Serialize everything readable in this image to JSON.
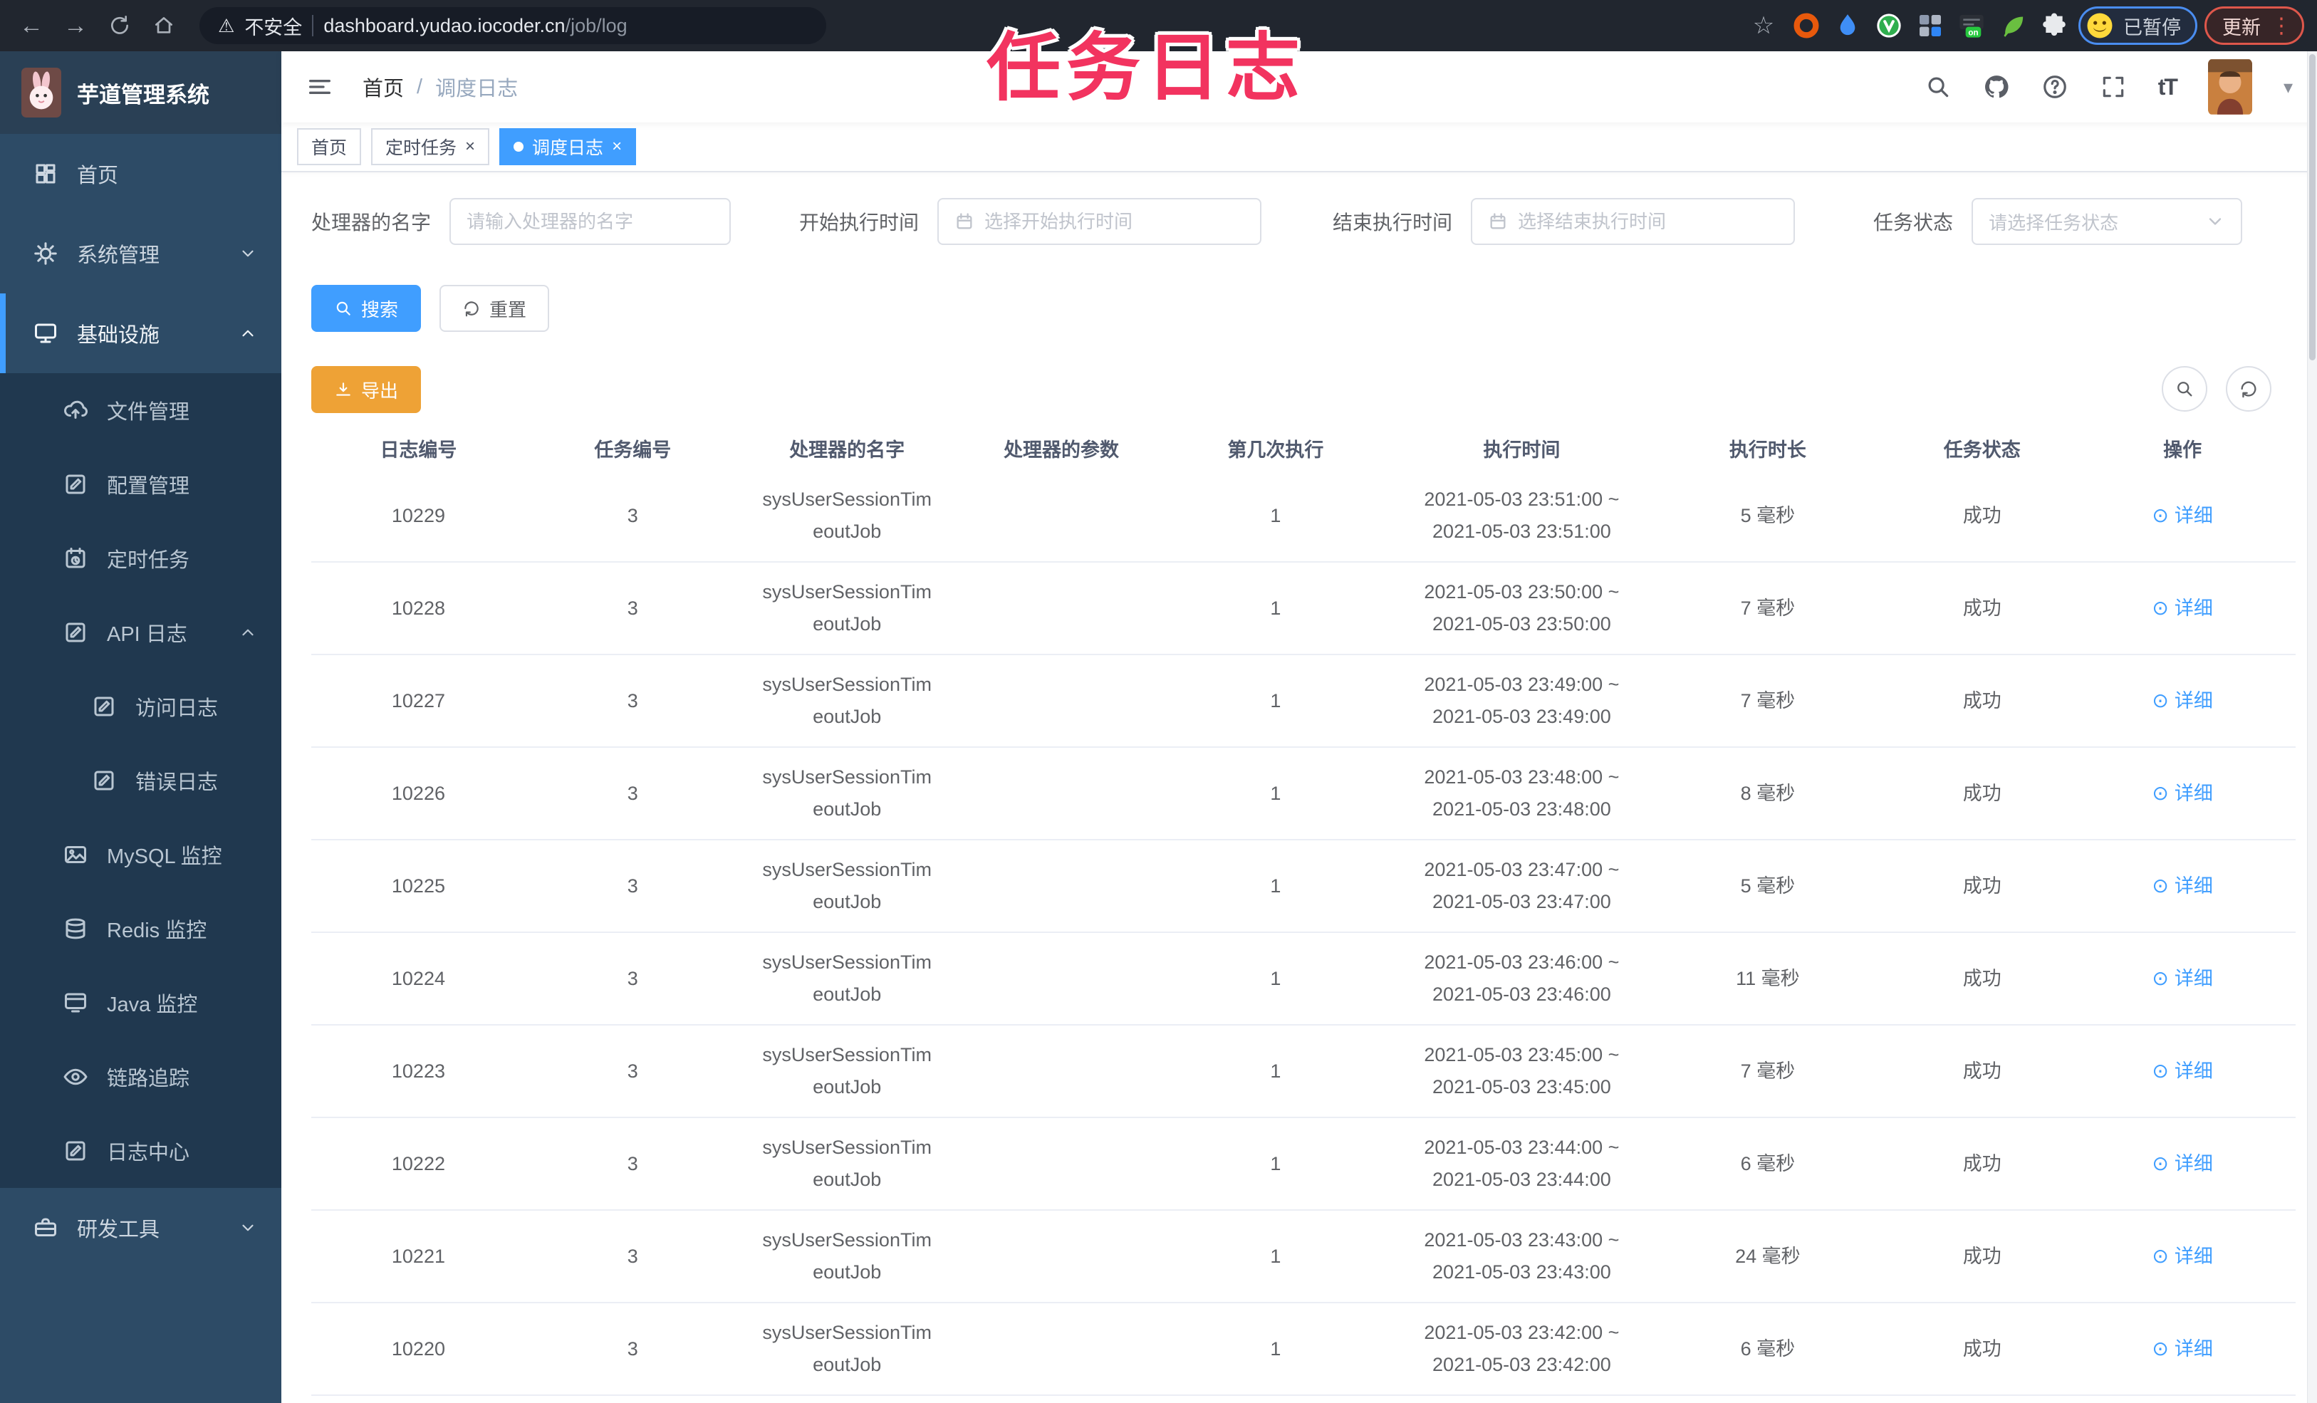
{
  "watermark": "任务日志",
  "colors": {
    "accent": "#409eff",
    "warning": "#eea236",
    "watermark_pink": "#f2335f",
    "sidebar_bg": "#2d4b66",
    "submenu_bg": "#20384f",
    "chrome_bg": "#21262f"
  },
  "browser": {
    "security_label": "不安全",
    "url_host": "dashboard.yudao.iocoder.cn",
    "url_path": "/job/log",
    "ext_on_label": "on",
    "profile_status": "已暂停",
    "update_label": "更新"
  },
  "sidebar": {
    "app_title": "芋道管理系统",
    "items": [
      {
        "label": "首页",
        "icon": "dashboard-icon",
        "level": 0
      },
      {
        "label": "系统管理",
        "icon": "gear-icon",
        "level": 0,
        "chevron": "down"
      },
      {
        "label": "基础设施",
        "icon": "monitor-icon",
        "level": 0,
        "chevron": "up",
        "active": true
      },
      {
        "label": "文件管理",
        "icon": "upload-cloud-icon",
        "level": 1
      },
      {
        "label": "配置管理",
        "icon": "edit-icon",
        "level": 1
      },
      {
        "label": "定时任务",
        "icon": "schedule-icon",
        "level": 1
      },
      {
        "label": "API 日志",
        "icon": "edit-icon",
        "level": 1,
        "chevron": "up"
      },
      {
        "label": "访问日志",
        "icon": "edit-icon",
        "level": 2
      },
      {
        "label": "错误日志",
        "icon": "edit-icon",
        "level": 2
      },
      {
        "label": "MySQL 监控",
        "icon": "picture-icon",
        "level": 1
      },
      {
        "label": "Redis 监控",
        "icon": "layers-icon",
        "level": 1
      },
      {
        "label": "Java 监控",
        "icon": "java-monitor-icon",
        "level": 1
      },
      {
        "label": "链路追踪",
        "icon": "eye-icon",
        "level": 1
      },
      {
        "label": "日志中心",
        "icon": "edit-icon",
        "level": 1
      },
      {
        "label": "研发工具",
        "icon": "briefcase-icon",
        "level": 0,
        "chevron": "down"
      }
    ]
  },
  "header": {
    "breadcrumb_home": "首页",
    "breadcrumb_separator": "/",
    "breadcrumb_current": "调度日志",
    "fontsize_label": "tT"
  },
  "tags": [
    {
      "label": "首页",
      "closable": false,
      "active": false
    },
    {
      "label": "定时任务",
      "closable": true,
      "active": false
    },
    {
      "label": "调度日志",
      "closable": true,
      "active": true
    }
  ],
  "filters": {
    "name_label": "处理器的名字",
    "name_placeholder": "请输入处理器的名字",
    "begin_label": "开始执行时间",
    "begin_placeholder": "选择开始执行时间",
    "end_label": "结束执行时间",
    "end_placeholder": "选择结束执行时间",
    "status_label": "任务状态",
    "status_placeholder": "请选择任务状态",
    "search_label": "搜索",
    "reset_label": "重置",
    "export_label": "导出"
  },
  "table": {
    "columns": [
      "日志编号",
      "任务编号",
      "处理器的名字",
      "处理器的参数",
      "第几次执行",
      "执行时间",
      "执行时长",
      "任务状态",
      "操作"
    ],
    "detail_label": "详细",
    "rows": [
      {
        "id": "10229",
        "job_id": "3",
        "handler_line1": "sysUserSessionTim",
        "handler_line2": "eoutJob",
        "param": "",
        "index": "1",
        "time_start": "2021-05-03 23:51:00 ~",
        "time_end": "2021-05-03 23:51:00",
        "duration": "5 毫秒",
        "status": "成功"
      },
      {
        "id": "10228",
        "job_id": "3",
        "handler_line1": "sysUserSessionTim",
        "handler_line2": "eoutJob",
        "param": "",
        "index": "1",
        "time_start": "2021-05-03 23:50:00 ~",
        "time_end": "2021-05-03 23:50:00",
        "duration": "7 毫秒",
        "status": "成功"
      },
      {
        "id": "10227",
        "job_id": "3",
        "handler_line1": "sysUserSessionTim",
        "handler_line2": "eoutJob",
        "param": "",
        "index": "1",
        "time_start": "2021-05-03 23:49:00 ~",
        "time_end": "2021-05-03 23:49:00",
        "duration": "7 毫秒",
        "status": "成功"
      },
      {
        "id": "10226",
        "job_id": "3",
        "handler_line1": "sysUserSessionTim",
        "handler_line2": "eoutJob",
        "param": "",
        "index": "1",
        "time_start": "2021-05-03 23:48:00 ~",
        "time_end": "2021-05-03 23:48:00",
        "duration": "8 毫秒",
        "status": "成功"
      },
      {
        "id": "10225",
        "job_id": "3",
        "handler_line1": "sysUserSessionTim",
        "handler_line2": "eoutJob",
        "param": "",
        "index": "1",
        "time_start": "2021-05-03 23:47:00 ~",
        "time_end": "2021-05-03 23:47:00",
        "duration": "5 毫秒",
        "status": "成功"
      },
      {
        "id": "10224",
        "job_id": "3",
        "handler_line1": "sysUserSessionTim",
        "handler_line2": "eoutJob",
        "param": "",
        "index": "1",
        "time_start": "2021-05-03 23:46:00 ~",
        "time_end": "2021-05-03 23:46:00",
        "duration": "11 毫秒",
        "status": "成功"
      },
      {
        "id": "10223",
        "job_id": "3",
        "handler_line1": "sysUserSessionTim",
        "handler_line2": "eoutJob",
        "param": "",
        "index": "1",
        "time_start": "2021-05-03 23:45:00 ~",
        "time_end": "2021-05-03 23:45:00",
        "duration": "7 毫秒",
        "status": "成功"
      },
      {
        "id": "10222",
        "job_id": "3",
        "handler_line1": "sysUserSessionTim",
        "handler_line2": "eoutJob",
        "param": "",
        "index": "1",
        "time_start": "2021-05-03 23:44:00 ~",
        "time_end": "2021-05-03 23:44:00",
        "duration": "6 毫秒",
        "status": "成功"
      },
      {
        "id": "10221",
        "job_id": "3",
        "handler_line1": "sysUserSessionTim",
        "handler_line2": "eoutJob",
        "param": "",
        "index": "1",
        "time_start": "2021-05-03 23:43:00 ~",
        "time_end": "2021-05-03 23:43:00",
        "duration": "24 毫秒",
        "status": "成功"
      },
      {
        "id": "10220",
        "job_id": "3",
        "handler_line1": "sysUserSessionTim",
        "handler_line2": "eoutJob",
        "param": "",
        "index": "1",
        "time_start": "2021-05-03 23:42:00 ~",
        "time_end": "2021-05-03 23:42:00",
        "duration": "6 毫秒",
        "status": "成功"
      }
    ]
  }
}
